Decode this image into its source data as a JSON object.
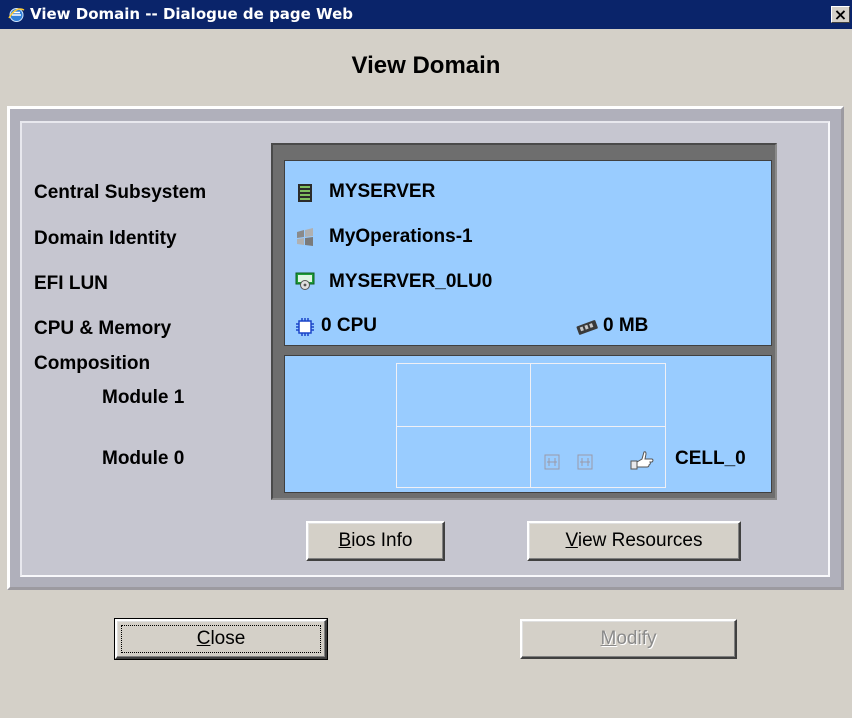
{
  "window": {
    "title": "View Domain -- Dialogue de page Web",
    "close_glyph": "×",
    "icon": "ie-icon"
  },
  "heading": "View Domain",
  "labels": {
    "central_subsystem": "Central Subsystem",
    "domain_identity": "Domain Identity",
    "efi_lun": "EFI LUN",
    "cpu_memory": "CPU & Memory",
    "composition": "Composition",
    "module_1": "Module 1",
    "module_0": "Module 0"
  },
  "values": {
    "central_subsystem": "MYSERVER",
    "domain_identity": "MyOperations-1",
    "efi_lun": "MYSERVER_0LU0",
    "cpu": "0 CPU",
    "memory": "0 MB",
    "cell": "CELL_0"
  },
  "icons": {
    "central_subsystem": "server-icon",
    "domain_identity": "windows-flag-icon",
    "efi_lun": "disk-lun-icon",
    "cpu": "cpu-chip-icon",
    "memory": "memory-module-icon"
  },
  "buttons": {
    "bios_info": {
      "label_first": "B",
      "label_rest": "ios Info"
    },
    "view_resources": {
      "label_first": "V",
      "label_rest": "iew Resources"
    },
    "close": {
      "label_first": "C",
      "label_rest": "lose"
    },
    "modify": {
      "label_first": "M",
      "label_rest": "odify"
    }
  },
  "colors": {
    "title_bar": "#0a246a",
    "info_background": "#99ccff",
    "dialog_background": "#d4d0c8"
  }
}
